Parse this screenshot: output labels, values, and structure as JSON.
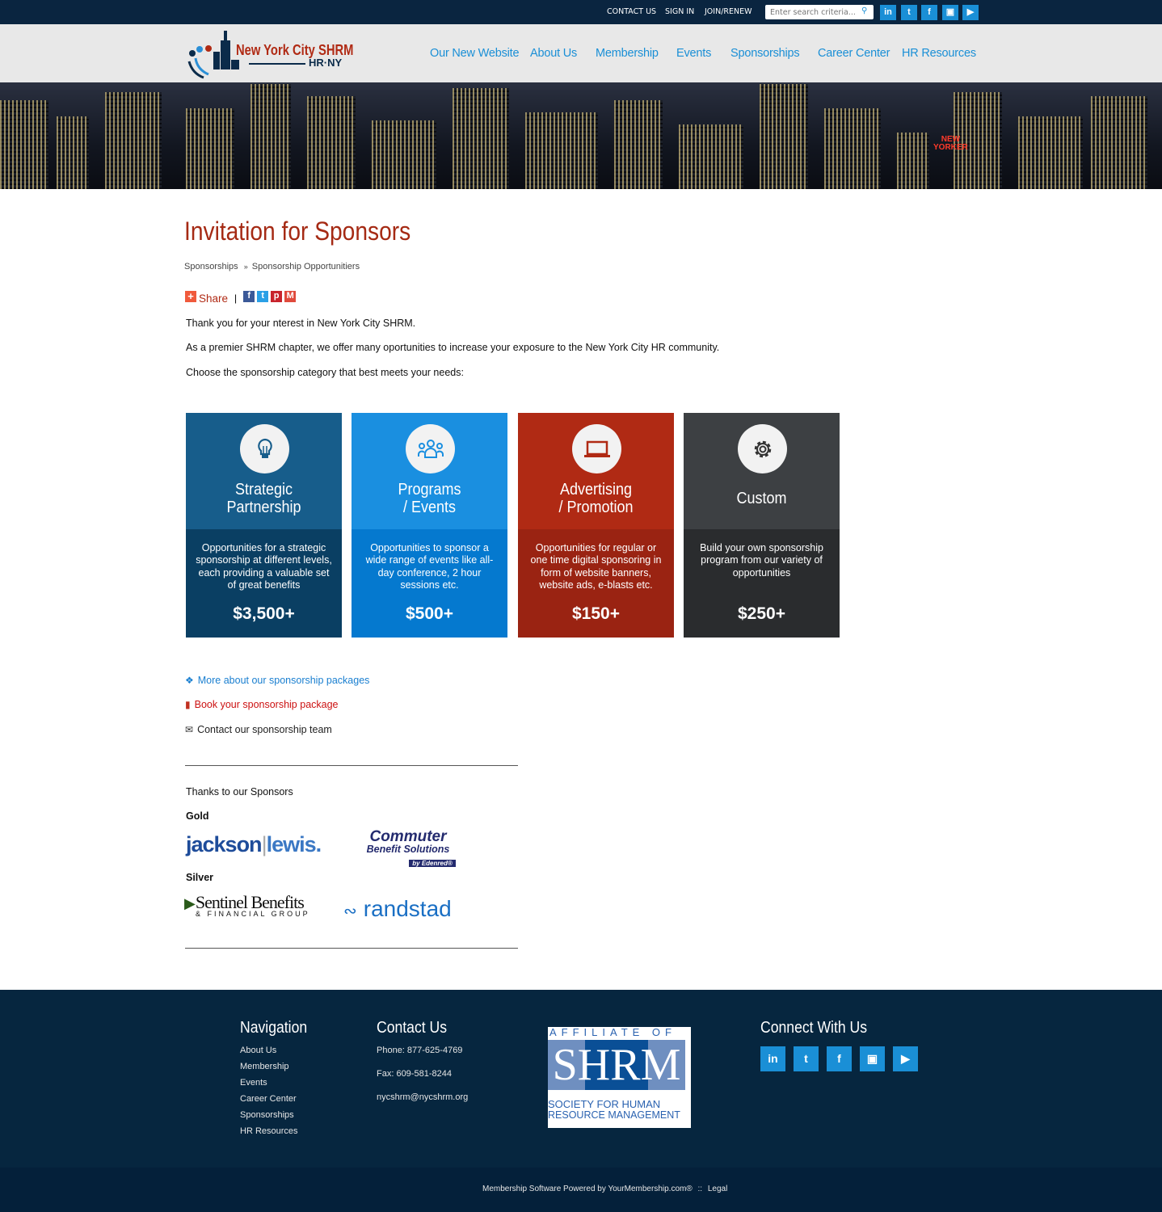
{
  "topbar": {
    "links": [
      "CONTACT US",
      "SIGN IN",
      "JOIN/RENEW"
    ],
    "search_placeholder": "Enter search criteria...",
    "social": [
      "linkedin-icon",
      "twitter-icon",
      "facebook-icon",
      "instagram-icon",
      "youtube-icon"
    ]
  },
  "logo": {
    "name": "New York City SHRM",
    "tagline": "HR·NY"
  },
  "nav": [
    "Our New Website",
    "About Us",
    "Membership",
    "Events",
    "Sponsorships",
    "Career Center",
    "HR Resources"
  ],
  "page": {
    "title": "Invitation for Sponsors",
    "breadcrumb": [
      "Sponsorships",
      "Sponsorship Opportunitiers"
    ],
    "breadcrumb_sep": "»",
    "share_label": "Share",
    "share_sep": "|",
    "paragraphs": [
      "Thank you for your nterest in New York City SHRM.",
      "As a premier SHRM chapter, we offer many oportunities to increase your exposure to the New York City HR community.",
      "Choose the sponsorship category that best meets your needs:"
    ]
  },
  "cards": [
    {
      "title1": "Strategic",
      "title2": "Partnership",
      "desc": "Opportunities for a strategic sponsorship at different levels, each providing a valuable set of great benefits",
      "price": "$3,500+",
      "icon": "lightbulb-icon",
      "top": "#175d8b",
      "bottom": "#0a3f63"
    },
    {
      "title1": "Programs",
      "title2": "/ Events",
      "desc": "Opportunities to sponsor a wide range of events like all-day conference, 2 hour sessions etc.",
      "price": "$500+",
      "icon": "people-icon",
      "top": "#1a8fe0",
      "bottom": "#0579cf"
    },
    {
      "title1": "Advertising",
      "title2": "/ Promotion",
      "desc": "Opportunities for regular or one time digital sponsoring in form of website banners, website ads, e-blasts etc.",
      "price": "$150+",
      "icon": "laptop-icon",
      "top": "#b02a14",
      "bottom": "#9a2312"
    },
    {
      "title1": "Custom",
      "title2": "",
      "desc": "Build your own sponsorship program from our variety of opportunities",
      "price": "$250+",
      "icon": "gear-icon",
      "top": "#3d4043",
      "bottom": "#2a2c2e"
    }
  ],
  "links": [
    {
      "label": "More about our sponsorship packages",
      "color": "#1a7fd0"
    },
    {
      "label": "Book your sponsorship package",
      "color": "#cc1111"
    },
    {
      "label": "Contact our sponsorship team",
      "color": "#222222"
    }
  ],
  "sponsors": {
    "heading": "Thanks to our Sponsors",
    "gold_label": "Gold",
    "silver_label": "Silver",
    "gold": [
      "jackson",
      "lewis.",
      "Commuter",
      "Benefit Solutions",
      "by Edenred®"
    ],
    "silver": [
      "Sentinel Benefits",
      "& FINANCIAL GROUP",
      "randstad"
    ]
  },
  "footer": {
    "nav_heading": "Navigation",
    "nav": [
      "About Us",
      "Membership",
      "Events",
      "Career Center",
      "Sponsorships",
      "HR Resources"
    ],
    "contact_heading": "Contact Us",
    "phone": "Phone: 877-625-4769",
    "fax": "Fax: 609-581-8244",
    "email": "nycshrm@nycshrm.org",
    "shrm": {
      "affiliate": "AFFILIATE OF",
      "letters": "SHRM",
      "line1": "SOCIETY FOR HUMAN",
      "line2": "RESOURCE MANAGEMENT"
    },
    "connect_heading": "Connect With Us",
    "powered": "Membership Software Powered by YourMembership.com®",
    "sep": "::",
    "legal": "Legal"
  }
}
